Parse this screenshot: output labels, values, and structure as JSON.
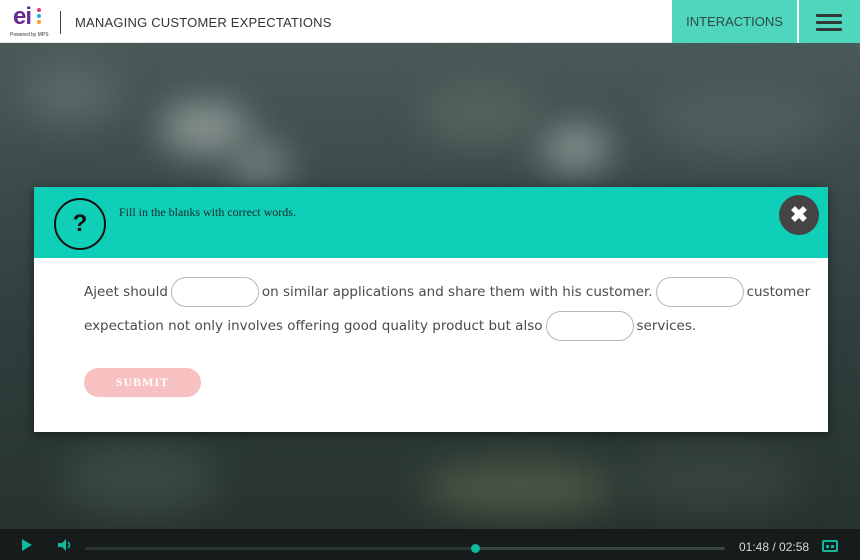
{
  "header": {
    "logo_text": "ei",
    "logo_subtext": "Powered by MPS",
    "title": "MANAGING CUSTOMER EXPECTATIONS",
    "interactions_label": "INTERACTIONS",
    "menu_icon": "hamburger-menu-icon"
  },
  "modal": {
    "question_icon": "?",
    "instruction": "Fill in the blanks with correct words.",
    "close_icon": "✖",
    "sentence": {
      "part1": "Ajeet should",
      "part2": "on similar applications and share them with his customer.",
      "part3": "customer",
      "part4": "expectation not only involves offering good quality product but also",
      "part5": "services."
    },
    "blanks": [
      {
        "value": "",
        "placeholder": ""
      },
      {
        "value": "",
        "placeholder": ""
      },
      {
        "value": "",
        "placeholder": ""
      }
    ],
    "submit_label": "SUBMIT"
  },
  "player": {
    "current_time": "01:48",
    "separator": " / ",
    "total_time": "02:58",
    "progress": 0.61,
    "accent_color": "#0fb79f"
  },
  "colors": {
    "teal_header": "#0fcfb8",
    "nav_button": "#4fd6bd",
    "submit_disabled": "#f6c1c0"
  }
}
